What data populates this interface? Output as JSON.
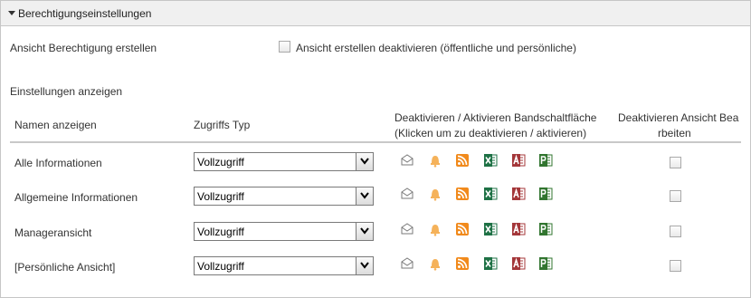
{
  "section": {
    "title": "Berechtigungseinstellungen"
  },
  "create": {
    "label": "Ansicht Berechtigung erstellen",
    "checkbox_label": "Ansicht erstellen deaktivieren (öffentliche und persönliche)"
  },
  "settings": {
    "label": "Einstellungen anzeigen"
  },
  "table": {
    "headers": {
      "name": "Namen anzeigen",
      "access": "Zugriffs Typ",
      "ribbon_line1": "Deaktivieren / Aktivieren Bandschaltfläche",
      "ribbon_line2": "(Klicken um zu deaktivieren / aktivieren)",
      "edit_line1": "Deaktivieren Ansicht Bea",
      "edit_line2": "rbeiten"
    },
    "rows": [
      {
        "name": "Alle Informationen",
        "access": "Vollzugriff"
      },
      {
        "name": "Allgemeine Informationen",
        "access": "Vollzugriff"
      },
      {
        "name": "Manageransicht",
        "access": "Vollzugriff"
      },
      {
        "name": "[Persönliche Ansicht]",
        "access": "Vollzugriff"
      }
    ]
  },
  "icons": [
    "email-icon",
    "bell-icon",
    "rss-icon",
    "excel-icon",
    "access-icon",
    "project-icon"
  ],
  "colors": {
    "header_bg": "#f0f0f0",
    "rss": "#f18a1c",
    "bell": "#f5b25a",
    "excel": "#1e7145",
    "access": "#a4373a",
    "project": "#31752f"
  }
}
